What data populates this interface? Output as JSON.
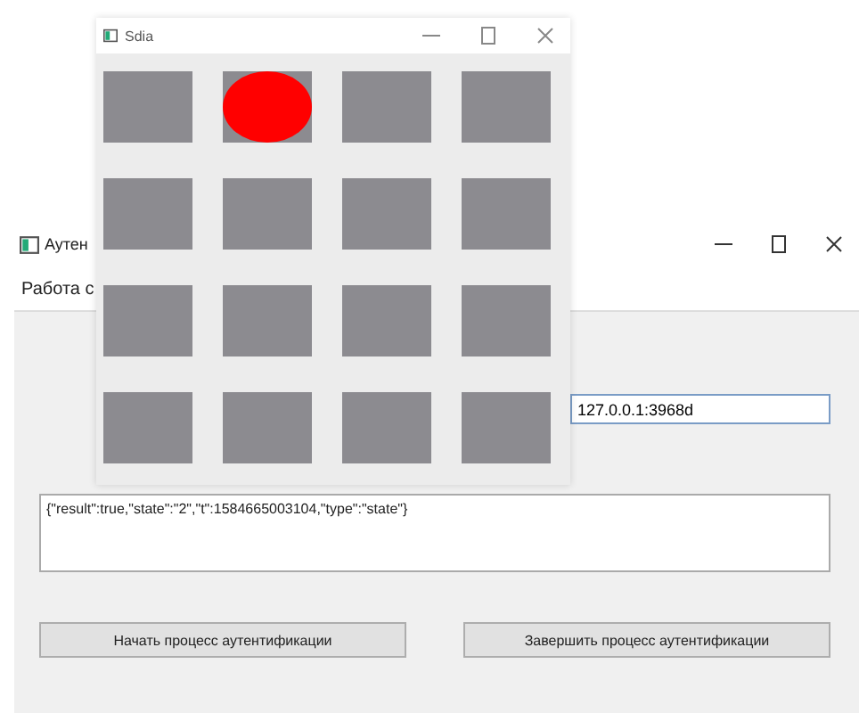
{
  "main_window": {
    "title": "Аутен",
    "menu": [
      "Работа с"
    ],
    "address_field": {
      "value": "127.0.0.1:3968d"
    },
    "output": {
      "text": "{\"result\":true,\"state\":\"2\",\"t\":1584665003104,\"type\":\"state\"}"
    },
    "buttons": [
      "Начать процесс аутентификации",
      "Завершить процесс аутентификации"
    ]
  },
  "popup_window": {
    "title": "Sdia",
    "cells": [
      {
        "marked": false
      },
      {
        "marked": true
      },
      {
        "marked": false
      },
      {
        "marked": false
      },
      {
        "marked": false
      },
      {
        "marked": false
      },
      {
        "marked": false
      },
      {
        "marked": false
      },
      {
        "marked": false
      },
      {
        "marked": false
      },
      {
        "marked": false
      },
      {
        "marked": false
      },
      {
        "marked": false
      },
      {
        "marked": false
      },
      {
        "marked": false
      },
      {
        "marked": false
      }
    ]
  }
}
